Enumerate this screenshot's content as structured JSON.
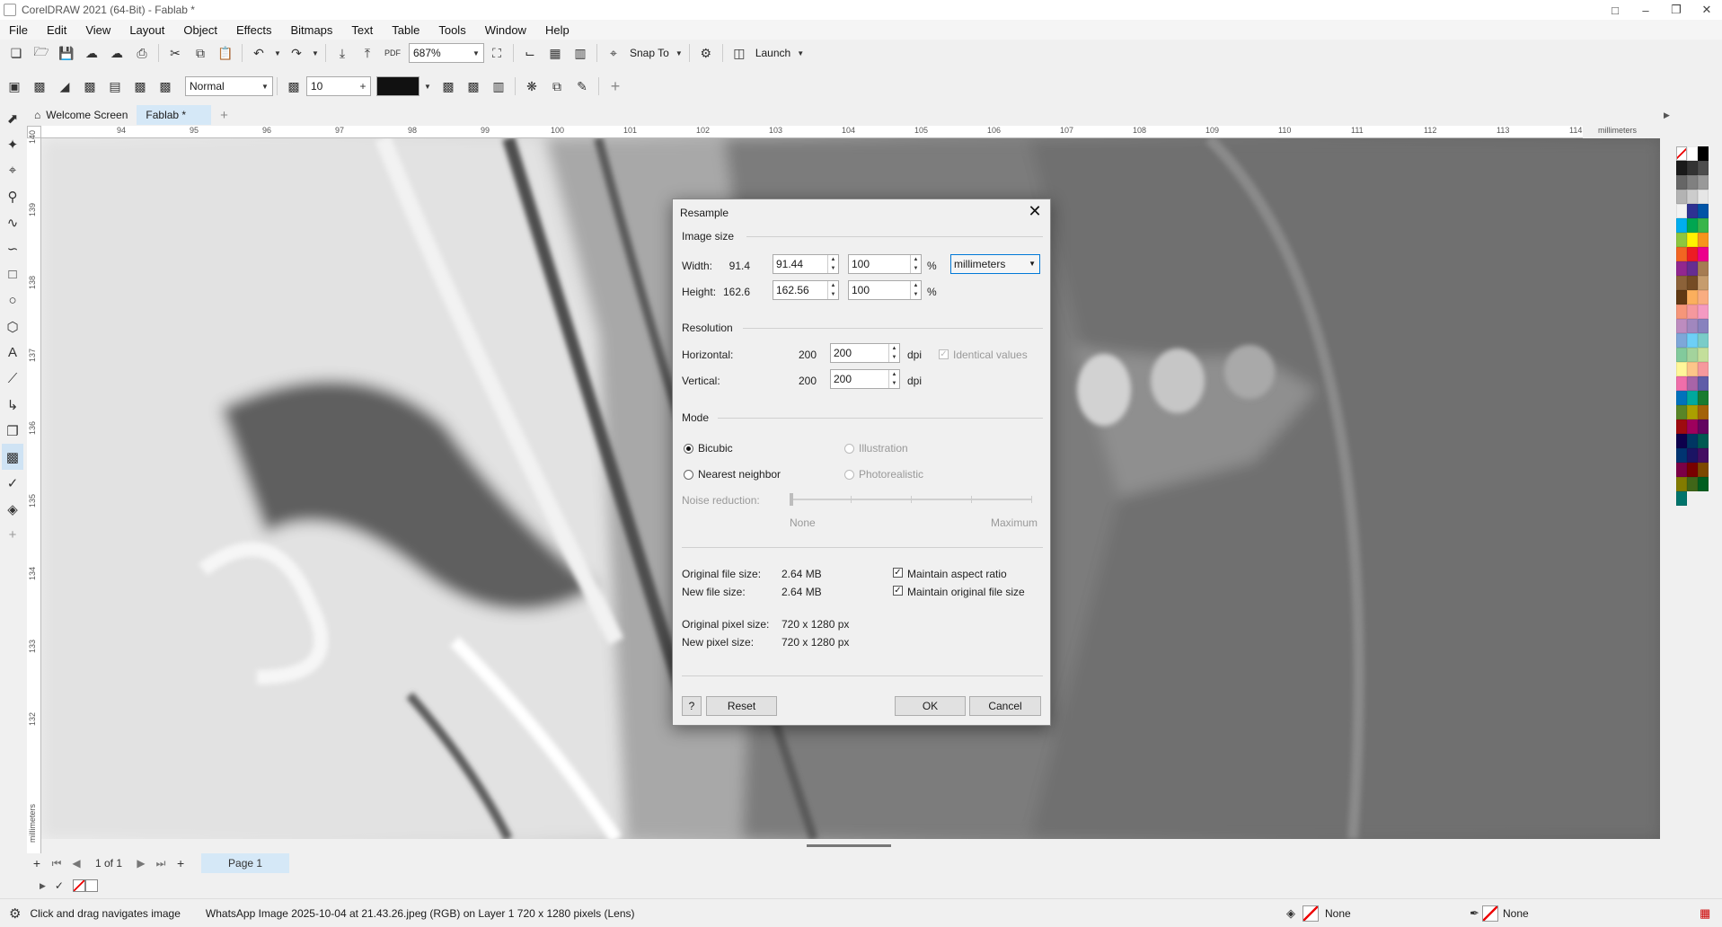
{
  "window": {
    "title": "CorelDRAW 2021 (64-Bit) - Fablab *"
  },
  "menu": [
    "File",
    "Edit",
    "View",
    "Layout",
    "Object",
    "Effects",
    "Bitmaps",
    "Text",
    "Table",
    "Tools",
    "Window",
    "Help"
  ],
  "toolbar": {
    "zoom": "687%",
    "snap_to": "Snap To",
    "launch": "Launch"
  },
  "property_bar": {
    "merge_mode": "Normal",
    "transparency": "10"
  },
  "tabs": {
    "welcome": "Welcome Screen",
    "document": "Fablab *"
  },
  "ruler": {
    "unit": "millimeters",
    "h_ticks": [
      "94",
      "95",
      "96",
      "97",
      "98",
      "99",
      "100",
      "101",
      "102",
      "103",
      "104",
      "105",
      "106",
      "107",
      "108",
      "109",
      "110",
      "111",
      "112",
      "113",
      "114"
    ],
    "v_ticks": [
      "140",
      "139",
      "138",
      "137",
      "136",
      "135",
      "134",
      "133",
      "132"
    ]
  },
  "dialog": {
    "title": "Resample",
    "image_size": {
      "section": "Image size",
      "width_label": "Width:",
      "width_orig": "91.4",
      "width_value": "91.44",
      "width_pct": "100",
      "height_label": "Height:",
      "height_orig": "162.6",
      "height_value": "162.56",
      "height_pct": "100",
      "pct": "%",
      "units": "millimeters"
    },
    "resolution": {
      "section": "Resolution",
      "h_label": "Horizontal:",
      "h_orig": "200",
      "h_value": "200",
      "v_label": "Vertical:",
      "v_orig": "200",
      "v_value": "200",
      "dpi": "dpi",
      "identical": "Identical values"
    },
    "mode": {
      "section": "Mode",
      "bicubic": "Bicubic",
      "nearest": "Nearest neighbor",
      "illustration": "Illustration",
      "photorealistic": "Photorealistic",
      "noise": "Noise reduction:",
      "noise_min": "None",
      "noise_max": "Maximum"
    },
    "info": {
      "orig_file_label": "Original file size:",
      "orig_file": "2.64 MB",
      "new_file_label": "New file size:",
      "new_file": "2.64 MB",
      "orig_px_label": "Original pixel size:",
      "orig_px": "720 x 1280 px",
      "new_px_label": "New pixel size:",
      "new_px": "720 x 1280 px",
      "maintain_aspect": "Maintain aspect ratio",
      "maintain_file": "Maintain original file size"
    },
    "buttons": {
      "help": "?",
      "reset": "Reset",
      "ok": "OK",
      "cancel": "Cancel"
    }
  },
  "page_nav": {
    "counter": "1 of 1",
    "page_tab": "Page 1"
  },
  "status": {
    "hint": "Click and drag navigates image",
    "info": "WhatsApp Image 2025-10-04 at 21.43.26.jpeg (RGB) on Layer 1 720 x 1280 pixels (Lens)",
    "fill": "None",
    "outline": "None"
  },
  "colors": {
    "accent": "#0078d7",
    "palette": [
      "#ffffff",
      "#000000",
      "#1a1a1a",
      "#333333",
      "#4d4d4d",
      "#666666",
      "#808080",
      "#999999",
      "#b3b3b3",
      "#cccccc",
      "#e6e6e6",
      "#f2f2f2",
      "#2e3192",
      "#0054a6",
      "#00aeef",
      "#00a651",
      "#39b54a",
      "#8dc63f",
      "#fff200",
      "#f7941d",
      "#f26522",
      "#ed1c24",
      "#ec008c",
      "#92278f",
      "#662d91",
      "#a67c52",
      "#8c6239",
      "#754c24",
      "#c69c6d",
      "#603913",
      "#fbaf5d",
      "#f9ad81",
      "#f69679",
      "#f5989d",
      "#f49ac2",
      "#bd8cbf",
      "#a187be",
      "#8882be",
      "#7ea7d8",
      "#6dcff6",
      "#7accc8",
      "#82ca9c",
      "#a3d39c",
      "#c4df9b",
      "#fff799",
      "#fdc689",
      "#f6989d",
      "#f06eaa",
      "#a864a8",
      "#605ca8",
      "#0072bc",
      "#00a99d",
      "#197b30",
      "#598527",
      "#aba000",
      "#a36209",
      "#9e0b0f",
      "#9e005d",
      "#630460",
      "#0d004c",
      "#003663",
      "#005952",
      "#003471",
      "#1b1464",
      "#440e62",
      "#7b0046",
      "#790000",
      "#7d4900",
      "#827b00",
      "#406618",
      "#005e20",
      "#00746b"
    ]
  }
}
